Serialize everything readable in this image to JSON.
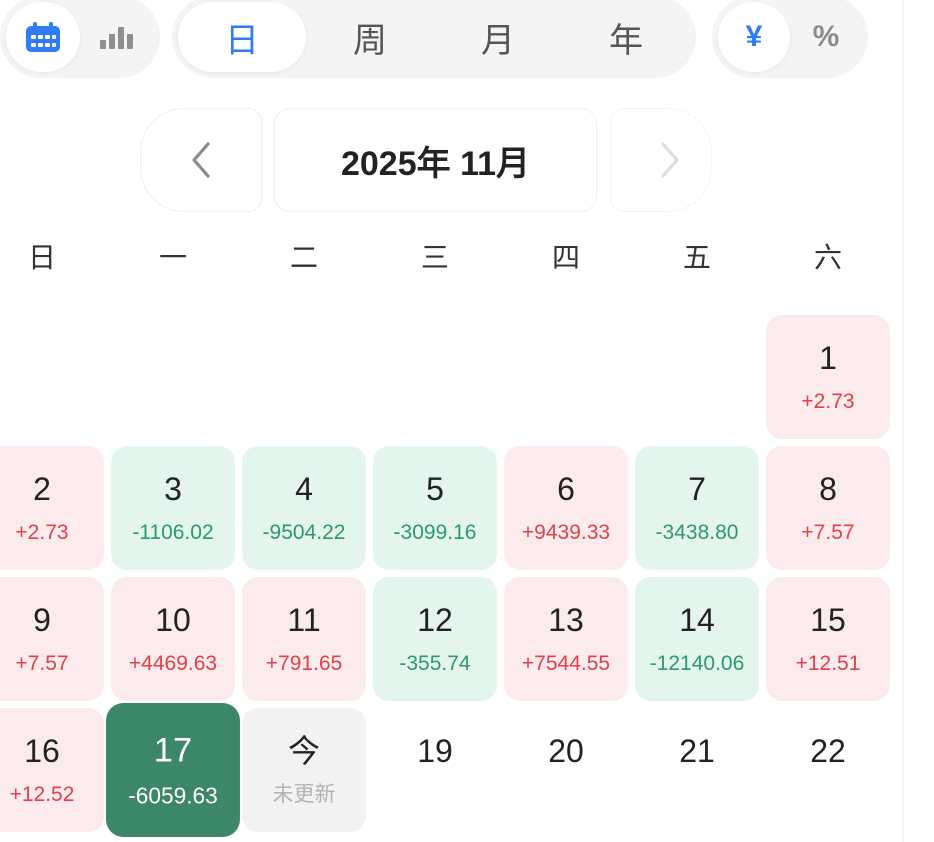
{
  "view_toggle": [
    {
      "icon": "calendar-icon",
      "selected": true
    },
    {
      "icon": "bar-chart-icon",
      "selected": false
    }
  ],
  "period_tabs": [
    {
      "label": "日",
      "selected": true
    },
    {
      "label": "周",
      "selected": false
    },
    {
      "label": "月",
      "selected": false
    },
    {
      "label": "年",
      "selected": false
    }
  ],
  "unit_toggle": [
    {
      "label": "¥",
      "selected": true
    },
    {
      "label": "%",
      "selected": false
    }
  ],
  "month_nav": {
    "prev_icon": "chevron-left-icon",
    "title": "2025年 11月",
    "next_icon": "chevron-right-icon",
    "next_disabled": true
  },
  "weekdays": [
    "日",
    "一",
    "二",
    "三",
    "四",
    "五",
    "六"
  ],
  "calendar": {
    "weeks": [
      [
        null,
        null,
        null,
        null,
        null,
        null,
        {
          "day": "1",
          "value": "+2.73",
          "status": "up"
        }
      ],
      [
        {
          "day": "2",
          "value": "+2.73",
          "status": "up"
        },
        {
          "day": "3",
          "value": "-1106.02",
          "status": "down"
        },
        {
          "day": "4",
          "value": "-9504.22",
          "status": "down"
        },
        {
          "day": "5",
          "value": "-3099.16",
          "status": "down"
        },
        {
          "day": "6",
          "value": "+9439.33",
          "status": "up"
        },
        {
          "day": "7",
          "value": "-3438.80",
          "status": "down"
        },
        {
          "day": "8",
          "value": "+7.57",
          "status": "up"
        }
      ],
      [
        {
          "day": "9",
          "value": "+7.57",
          "status": "up"
        },
        {
          "day": "10",
          "value": "+4469.63",
          "status": "up"
        },
        {
          "day": "11",
          "value": "+791.65",
          "status": "up"
        },
        {
          "day": "12",
          "value": "-355.74",
          "status": "down"
        },
        {
          "day": "13",
          "value": "+7544.55",
          "status": "up"
        },
        {
          "day": "14",
          "value": "-12140.06",
          "status": "down"
        },
        {
          "day": "15",
          "value": "+12.51",
          "status": "up"
        }
      ],
      [
        {
          "day": "16",
          "value": "+12.52",
          "status": "up"
        },
        {
          "day": "17",
          "value": "-6059.63",
          "status": "down",
          "selected": true
        },
        {
          "day": "今",
          "value": "未更新",
          "status": "pending"
        },
        {
          "day": "19",
          "status": "future"
        },
        {
          "day": "20",
          "status": "future"
        },
        {
          "day": "21",
          "status": "future"
        },
        {
          "day": "22",
          "status": "future"
        }
      ]
    ]
  },
  "colors": {
    "accent": "#2f7cf6",
    "up_text": "#e2414b",
    "up_bg": "#fcebec",
    "down_text": "#2c9a6a",
    "down_bg": "#e3f5ed",
    "selected_bg": "#3b8768",
    "pending_bg": "#f2f2f2",
    "pending_text": "#b3b3b3"
  }
}
